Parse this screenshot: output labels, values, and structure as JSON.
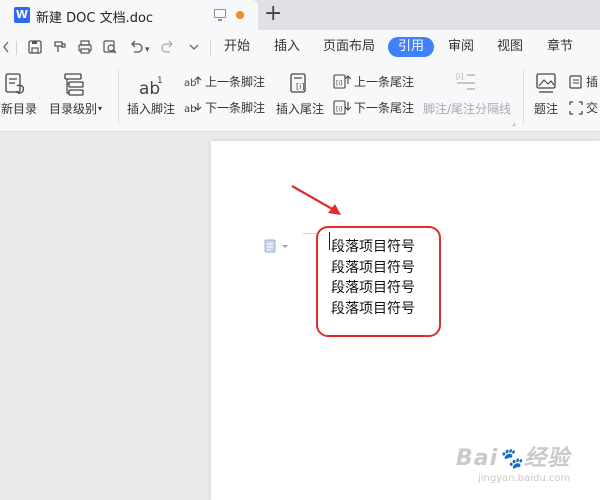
{
  "window": {
    "tab_title": "新建 DOC 文档.doc",
    "doc_icon_letter": "W",
    "new_tab": "+"
  },
  "menu": {
    "items": [
      "开始",
      "插入",
      "页面布局",
      "引用",
      "审阅",
      "视图",
      "章节"
    ],
    "active": "引用"
  },
  "ribbon": {
    "update_toc": "新目录",
    "toc_level": "目录级别",
    "insert_footnote": "插入脚注",
    "prev_footnote": "上一条脚注",
    "next_footnote": "下一条脚注",
    "insert_endnote": "插入尾注",
    "prev_endnote": "上一条尾注",
    "next_endnote": "下一条尾注",
    "footnote_separator": "脚注/尾注分隔线",
    "caption": "题注",
    "insert_cut": "插",
    "cross_ref_cut": "交"
  },
  "document": {
    "lines": [
      "段落项目符号",
      "段落项目符号",
      "段落项目符号",
      "段落项目符号"
    ]
  },
  "annotation": {
    "color": "#e02c2c"
  },
  "colors": {
    "accent": "#3f82f7",
    "unsaved": "#f28b1c"
  }
}
